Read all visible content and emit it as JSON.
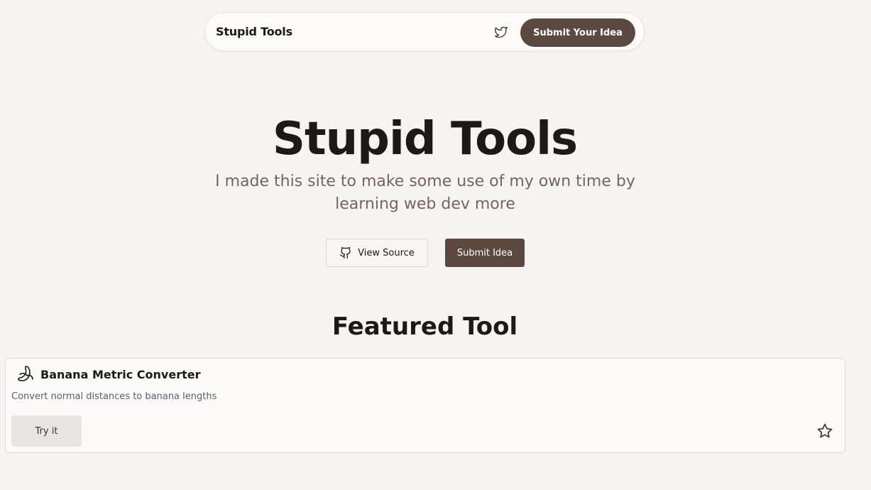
{
  "nav": {
    "brand": "Stupid Tools",
    "twitter_icon": "twitter-icon",
    "cta_label": "Submit Your Idea"
  },
  "hero": {
    "title": "Stupid Tools",
    "subtitle": "I made this site to make some use of my own time by learning web dev more",
    "source_label": "View Source",
    "source_icon": "github-icon",
    "idea_label": "Submit Idea"
  },
  "featured": {
    "heading": "Featured Tool",
    "tool": {
      "icon": "banana-icon",
      "name": "Banana Metric Converter",
      "description": "Convert normal distances to banana lengths",
      "try_label": "Try it",
      "favorite_icon": "star-icon"
    }
  },
  "colors": {
    "background": "#f6f4f2",
    "accent": "#5c4a40",
    "subtitle": "#75655c"
  }
}
